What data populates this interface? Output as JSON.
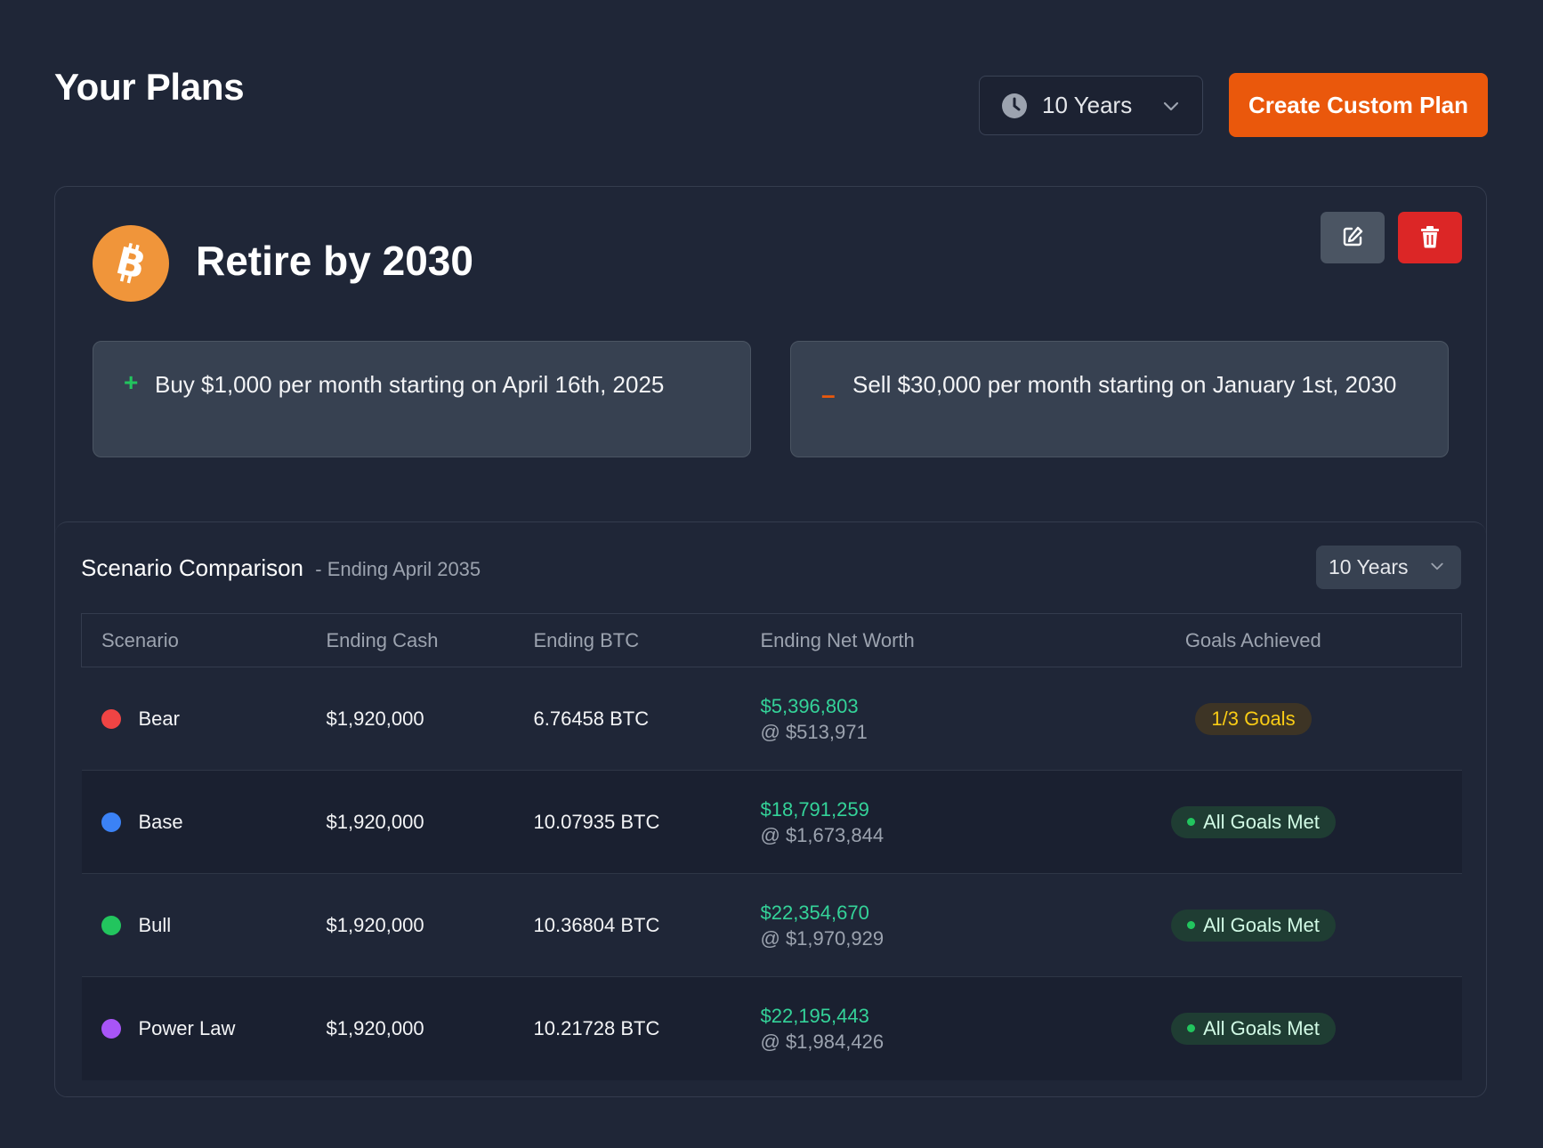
{
  "header": {
    "title": "Your Plans",
    "period_select": {
      "value": "10 Years",
      "icon": "clock-icon"
    },
    "create_button": "Create Custom Plan"
  },
  "plan": {
    "name": "Retire by 2030",
    "logo_icon": "bitcoin-icon",
    "edit_icon": "edit-icon",
    "delete_icon": "trash-icon",
    "actions": [
      {
        "type": "buy",
        "sign": "+",
        "text": "Buy $1,000 per month starting on April 16th, 2025"
      },
      {
        "type": "sell",
        "sign": "–",
        "text": "Sell $30,000 per month starting on January 1st, 2030"
      }
    ]
  },
  "scenario_comparison": {
    "title": "Scenario Comparison",
    "subtitle": "- Ending April 2035",
    "period_select": "10 Years",
    "columns": [
      "Scenario",
      "Ending Cash",
      "Ending BTC",
      "Ending Net Worth",
      "Goals Achieved"
    ],
    "rows": [
      {
        "scenario": "Bear",
        "color": "#ef4444",
        "ending_cash": "$1,920,000",
        "ending_btc": "6.76458 BTC",
        "net_worth": "$5,396,803",
        "btc_price": "@ $513,971",
        "goals": "1/3 Goals",
        "goals_status": "partial"
      },
      {
        "scenario": "Base",
        "color": "#3b82f6",
        "ending_cash": "$1,920,000",
        "ending_btc": "10.07935 BTC",
        "net_worth": "$18,791,259",
        "btc_price": "@ $1,673,844",
        "goals": "All Goals Met",
        "goals_status": "met"
      },
      {
        "scenario": "Bull",
        "color": "#22c55e",
        "ending_cash": "$1,920,000",
        "ending_btc": "10.36804 BTC",
        "net_worth": "$22,354,670",
        "btc_price": "@ $1,970,929",
        "goals": "All Goals Met",
        "goals_status": "met"
      },
      {
        "scenario": "Power Law",
        "color": "#a855f7",
        "ending_cash": "$1,920,000",
        "ending_btc": "10.21728 BTC",
        "net_worth": "$22,195,443",
        "btc_price": "@ $1,984,426",
        "goals": "All Goals Met",
        "goals_status": "met"
      }
    ]
  },
  "colors": {
    "background": "#1f2637",
    "accent": "#ea580c",
    "bitcoin": "#f0953a",
    "danger": "#dc2626",
    "positive": "#34d399"
  }
}
